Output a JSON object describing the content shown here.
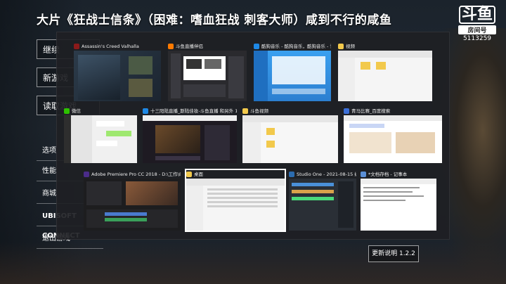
{
  "title": "大片《狂战士信条》（困难：嗜血狂战 刺客大师）咸到不行的咸鱼",
  "logo": {
    "mark": "斗鱼",
    "sub": "房间号",
    "room": "5113259"
  },
  "left_menu": {
    "continue": "继续",
    "new_game": "新游戏",
    "load_game": "读取游戏",
    "options": "选项",
    "perf": "性能",
    "store": "商城",
    "ubisoft": "UBISOFT CONNECT",
    "quit": "退出游戏"
  },
  "update_button": "更新说明 1.2.2",
  "switcher": {
    "windows": [
      {
        "title": "Assassin's Creed Valhalla",
        "icon_color": "#8b1a1a"
      },
      {
        "title": "斗鱼直播伴侣",
        "icon_color": "#ff7a00"
      },
      {
        "title": "酷狗音乐 - 酷狗音乐，酷狗音乐 - 让音乐...",
        "icon_color": "#1e88e5"
      },
      {
        "title": "视频",
        "icon_color": "#f2c94c"
      },
      {
        "title": "微信",
        "icon_color": "#2dc100"
      },
      {
        "title": "十三阳陆直播_斯陆佳妆-斗鱼直播 和另外 1...",
        "icon_color": "#1e88e5"
      },
      {
        "title": "斗鱼视频",
        "icon_color": "#f2c94c"
      },
      {
        "title": "青马比赛_百度搜索",
        "icon_color": "#3b6fd8"
      },
      {
        "title": "Adobe Premiere Pro CC 2018 - D:\\工作\\8.21\\工程文...",
        "icon_color": "#4b2c8a"
      },
      {
        "title": "桌面",
        "icon_color": "#f2c94c"
      },
      {
        "title": "Studio One - 2021-08-15 编程档测...",
        "icon_color": "#2b6cb0"
      },
      {
        "title": "*文档存档 - 记事本",
        "icon_color": "#5b8fd6"
      }
    ]
  },
  "colors": {
    "valhalla": "#2c3b4a",
    "douyu": "#2a2a2e",
    "kugou": "#3aa0f0",
    "explorer": "#f5f5f5",
    "wechat": "#f0f0f0",
    "browser": "#1e1a22",
    "baidu": "#ffffff",
    "premiere": "#1d1d1f",
    "studio": "#2a2f36",
    "notepad": "#ffffff"
  }
}
